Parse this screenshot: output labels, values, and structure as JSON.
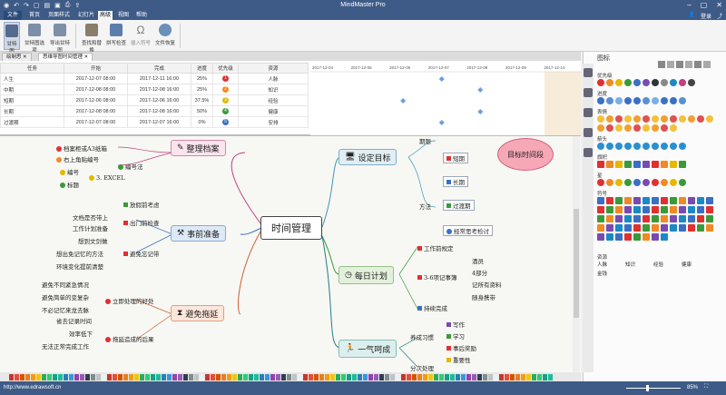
{
  "app": {
    "title": "MindMaster Pro"
  },
  "menu": {
    "file": "文件",
    "tabs": [
      "首页",
      "页面样式",
      "幻灯片",
      "高级",
      "视图",
      "帮助"
    ],
    "login": "登录",
    "active_tab": "高级"
  },
  "ribbon": {
    "buttons": [
      "甘特图",
      "甘特图选项",
      "导出甘特图",
      "查找和替换",
      "拼写检查",
      "插入符号",
      "文件恢复"
    ]
  },
  "doc_tabs": [
    "绘制思",
    "思维导图时间管理"
  ],
  "gantt": {
    "headers": [
      "任务",
      "开始",
      "完成",
      "进度",
      "优先级",
      "资源"
    ],
    "rows": [
      {
        "task": "人生",
        "start": "2017-12-07 08:00",
        "end": "2017-12-11 16:00",
        "progress": "25%",
        "priority": "1",
        "resource": "人脉",
        "color": "#e03030"
      },
      {
        "task": "中期",
        "start": "2017-12-08 08:00",
        "end": "2017-12-08 16:00",
        "progress": "25%",
        "priority": "2",
        "resource": "知识",
        "color": "#f08a24"
      },
      {
        "task": "短期",
        "start": "2017-12-06 08:00",
        "end": "2017-12-06 16:00",
        "progress": "37.5%",
        "priority": "3",
        "resource": "经验",
        "color": "#e6b800"
      },
      {
        "task": "长期",
        "start": "2017-12-08 08:00",
        "end": "2017-12-08 16:00",
        "progress": "50%",
        "priority": "4",
        "resource": "健康",
        "color": "#3a9a3a"
      },
      {
        "task": "过渡期",
        "start": "2017-12-07 08:00",
        "end": "2017-12-07 16:00",
        "progress": "0%",
        "priority": "5",
        "resource": "安排",
        "color": "#3a6fc4"
      }
    ],
    "dates": [
      "2017-12-04",
      "2017-12-05",
      "2017-12-06",
      "2017-12-07",
      "2017-12-08",
      "2017-12-09",
      "2017-12-10"
    ]
  },
  "mindmap": {
    "center": "时间管理",
    "left": {
      "organize": {
        "title": "整理档案",
        "items": [
          "档案柜或A3纸箱",
          "右上角贴编号",
          "编号法",
          "编号",
          "标题",
          "3. EXCEL"
        ]
      },
      "prepare": {
        "title": "事前准备",
        "items": [
          "放假前考虑",
          "文档是否带上",
          "工作计划准备",
          "出门前检查",
          "想到文剑做",
          "想出免记忆的方法",
          "避免忘记带",
          "环境变化提前清楚"
        ]
      },
      "avoid": {
        "title": "避免拖延",
        "items": [
          "避免不同紧急情况",
          "避免简单的变复杂",
          "不必记忆来龙去脉",
          "省去记录时间",
          "立即处理的好处",
          "效率低下",
          "无法正常完成工作",
          "拖延造成的后果"
        ]
      }
    },
    "right": {
      "goal": {
        "title": "设定目标",
        "items": [
          "期限",
          "短期",
          "长期",
          "过渡期",
          "经常思考检讨",
          "方法"
        ],
        "cloud": "目标时间段"
      },
      "daily": {
        "title": "每日计划",
        "items": [
          "工作前规定",
          "3-6项记事簿",
          "酒员",
          "4部分",
          "记所有资料",
          "随身携带",
          "持续完成"
        ]
      },
      "flow": {
        "title": "一气呵成",
        "items": [
          "养成习惯",
          "写作",
          "学习",
          "事后奖励",
          "重要性",
          "分次处理"
        ]
      }
    }
  },
  "panel": {
    "title": "图标",
    "sections": [
      "优先级",
      "进度",
      "表情",
      "箭头",
      "旗帜",
      "星",
      "符号",
      "资源"
    ],
    "resources": [
      "人脉",
      "知识",
      "经验",
      "健康",
      "金钱"
    ]
  },
  "status": {
    "url": "http://www.edrawsoft.cn",
    "zoom": "85%"
  }
}
